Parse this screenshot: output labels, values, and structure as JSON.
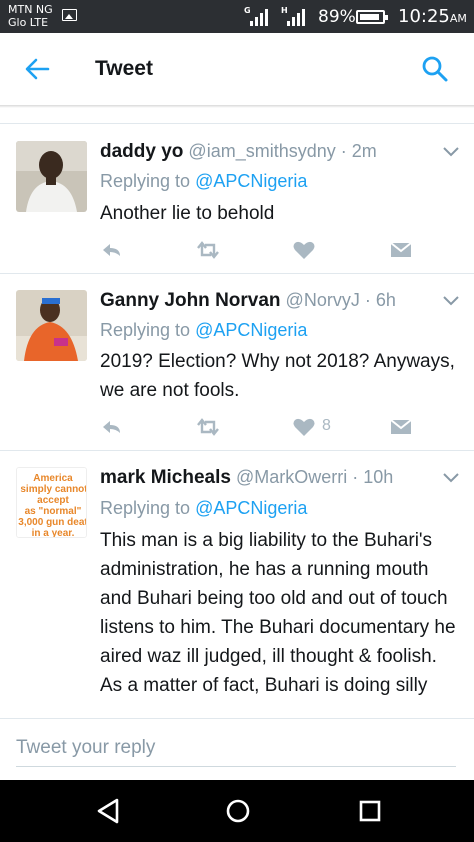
{
  "status_bar": {
    "carrier_line1": "MTN NG",
    "carrier_line2": "Glo LTE",
    "signal1_label": "G",
    "signal2_label": "H",
    "battery_percent": "89%",
    "battery_level": 0.89,
    "time": "10:25",
    "ampm": "AM"
  },
  "header": {
    "title": "Tweet",
    "accent_color": "#1da1f2"
  },
  "tweets": [
    {
      "name": "daddy yo",
      "handle": "@iam_smithsydny",
      "time": "· 2m",
      "reply_to_prefix": "Replying to",
      "reply_to_handle": "@APCNigeria",
      "text": "Another lie to behold",
      "like_count": ""
    },
    {
      "name": "Ganny John Norvan",
      "handle": "@NorvyJ",
      "time": "· 6h",
      "reply_to_prefix": "Replying to",
      "reply_to_handle": "@APCNigeria",
      "text": "2019? Election? Why not 2018? Anyways, we are not fools.",
      "like_count": "8"
    },
    {
      "name": "mark Micheals",
      "handle": "@MarkOwerri",
      "time": "· 10h",
      "reply_to_prefix": "Replying to",
      "reply_to_handle": "@APCNigeria",
      "text": "This man is a big liability to the Buhari's administration, he has a running mouth and Buhari being too old and out of touch listens to him. The Buhari documentary he aired waz ill judged, ill thought & foolish. As a matter of fact, Buhari is doing silly",
      "avatar_text": [
        "America",
        "simply cannot",
        "accept",
        "as \"normal\"",
        "3,000 gun deat",
        "in a year."
      ],
      "like_count": ""
    }
  ],
  "composer": {
    "placeholder": "Tweet your reply"
  },
  "icons": {
    "back": "back-arrow-icon",
    "search": "search-icon",
    "reply": "reply-icon",
    "retweet": "retweet-icon",
    "like": "heart-icon",
    "dm": "envelope-icon",
    "caret": "chevron-down-icon"
  }
}
